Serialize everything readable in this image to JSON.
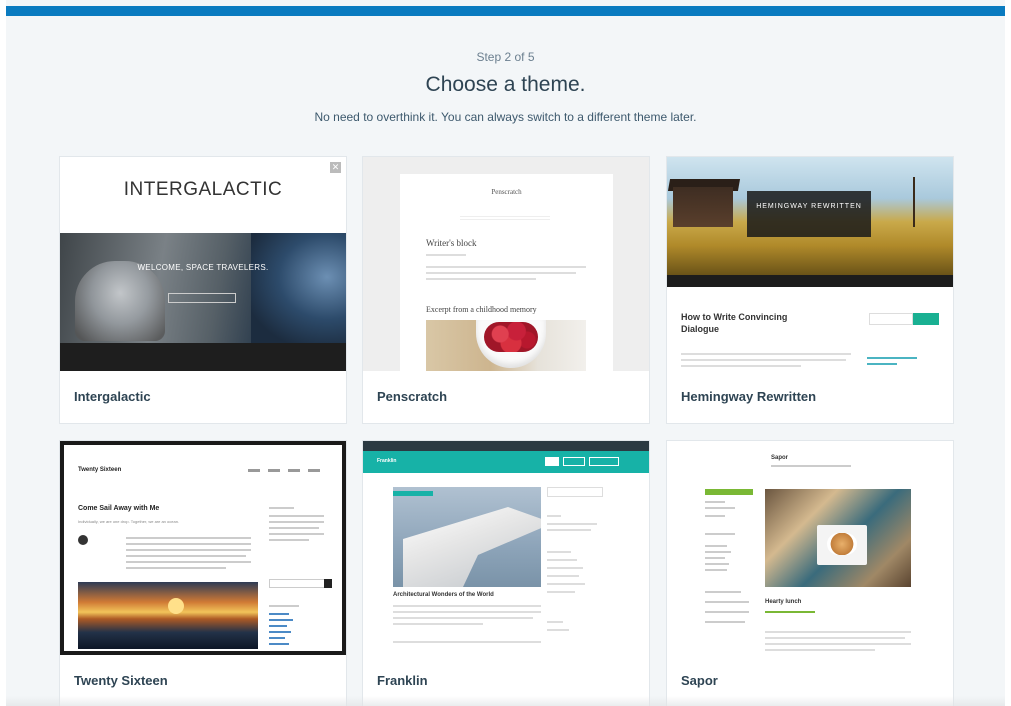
{
  "header": {
    "step": "Step 2 of 5",
    "title": "Choose a theme.",
    "subtitle": "No need to overthink it. You can always switch to a different theme later."
  },
  "themes": [
    {
      "name": "Intergalactic",
      "preview": {
        "logo": "INTERGALACTIC",
        "hero_text": "WELCOME, SPACE TRAVELERS."
      }
    },
    {
      "name": "Penscratch",
      "preview": {
        "site_title": "Penscratch",
        "post_title": "Writer's block",
        "post_title_2": "Excerpt from a childhood memory"
      }
    },
    {
      "name": "Hemingway Rewritten",
      "preview": {
        "hero_title": "HEMINGWAY REWRITTEN",
        "post_title": "How to Write Convincing Dialogue"
      }
    },
    {
      "name": "Twenty Sixteen",
      "preview": {
        "site_title": "Twenty Sixteen",
        "post_title": "Come Sail Away with Me",
        "post_sub": "Individually, we are one drop. Together, we are an ocean."
      }
    },
    {
      "name": "Franklin",
      "preview": {
        "brand": "Franklin",
        "post_title": "Architectural Wonders of the World"
      }
    },
    {
      "name": "Sapor",
      "preview": {
        "site_title": "Sapor",
        "post_title": "Hearty lunch"
      }
    }
  ],
  "colors": {
    "accent_bar": "#0a7bc0",
    "background": "#f3f6f8",
    "title_text": "#2e4453"
  }
}
